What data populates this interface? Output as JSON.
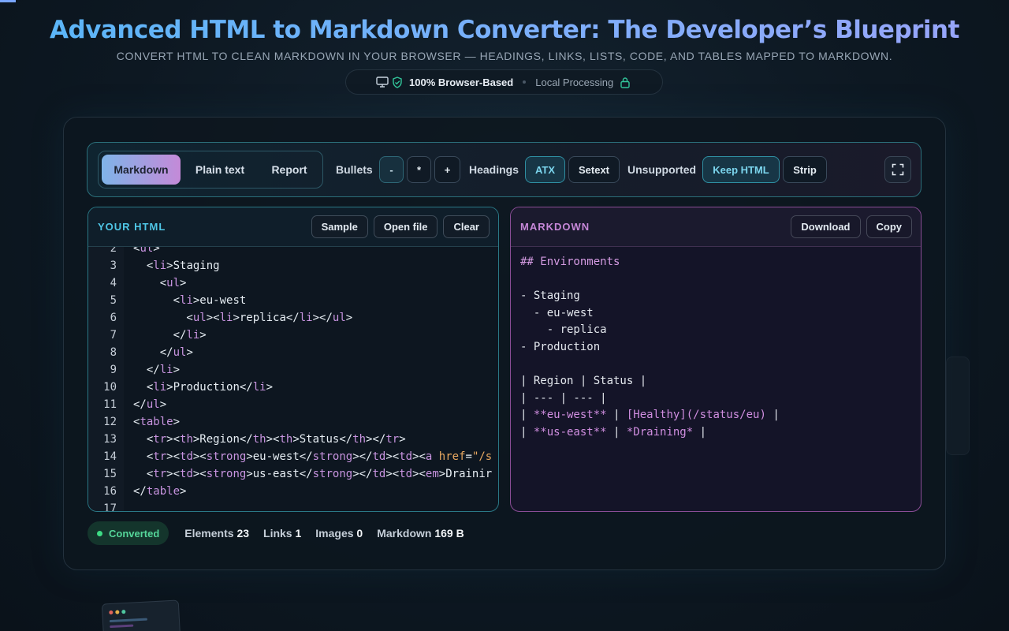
{
  "header": {
    "title": "Advanced HTML to Markdown Converter: The Developer’s Blueprint",
    "subtitle": "CONVERT HTML TO CLEAN MARKDOWN IN YOUR BROWSER — HEADINGS, LINKS, LISTS, CODE, AND TABLES MAPPED TO MARKDOWN.",
    "badge_strong": "100% Browser-Based",
    "badge_muted": "Local Processing"
  },
  "toolbar": {
    "modes": [
      "Markdown",
      "Plain text",
      "Report"
    ],
    "active_mode": "Markdown",
    "bullets_label": "Bullets",
    "bullets": [
      "-",
      "*",
      "+"
    ],
    "active_bullet": "-",
    "headings_label": "Headings",
    "headings": [
      "ATX",
      "Setext"
    ],
    "active_heading": "ATX",
    "unsupported_label": "Unsupported",
    "unsupported": [
      "Keep HTML",
      "Strip"
    ],
    "active_unsupported": "Keep HTML"
  },
  "html_panel": {
    "title": "YOUR HTML",
    "buttons": [
      "Sample",
      "Open file",
      "Clear"
    ],
    "line_numbers": [
      "2",
      "3",
      "4",
      "5",
      "6",
      "7",
      "8",
      "9",
      "10",
      "11",
      "12",
      "13",
      "14",
      "15",
      "16",
      "17"
    ],
    "lines": [
      "<ul>",
      "  <li>Staging",
      "    <ul>",
      "      <li>eu-west",
      "        <ul><li>replica</li></ul>",
      "      </li>",
      "    </ul>",
      "  </li>",
      "  <li>Production</li>",
      "</ul>",
      "<table>",
      "  <tr><th>Region</th><th>Status</th></tr>",
      "  <tr><td><strong>eu-west</strong></td><td><a href=\"/s",
      "  <tr><td><strong>us-east</strong></td><td><em>Drainir",
      "</table>",
      ""
    ]
  },
  "markdown_panel": {
    "title": "MARKDOWN",
    "buttons": [
      "Download",
      "Copy"
    ],
    "lines": [
      "## Environments",
      "",
      "- Staging",
      "  - eu-west",
      "    - replica",
      "- Production",
      "",
      "| Region | Status |",
      "| --- | --- |",
      "| **eu-west** | [Healthy](/status/eu) |",
      "| **us-east** | *Draining* |"
    ]
  },
  "status": {
    "state": "Converted",
    "elements_label": "Elements",
    "elements": "23",
    "links_label": "Links",
    "links": "1",
    "images_label": "Images",
    "images": "0",
    "markdown_label": "Markdown",
    "markdown": "169 B"
  },
  "colors": {
    "accent_cyan": "#4fc6e6",
    "accent_magenta": "#c687d8",
    "success": "#3ddc84"
  },
  "icons": [
    "monitor-icon",
    "shield-check-icon",
    "lock-icon",
    "fullscreen-icon"
  ]
}
